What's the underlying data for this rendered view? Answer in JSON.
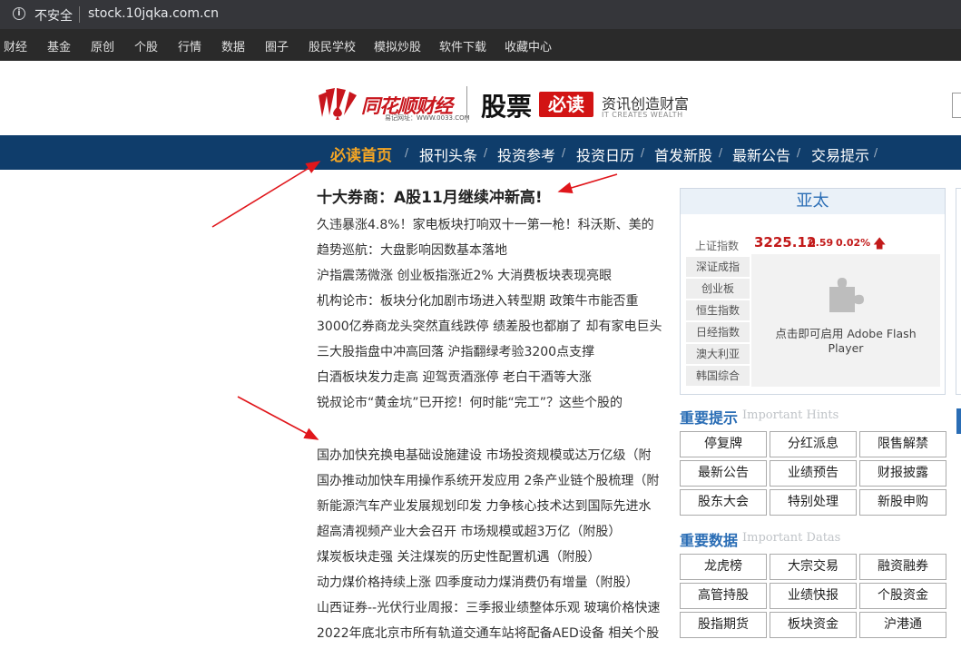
{
  "browser": {
    "security_label": "不安全",
    "url": "stock.10jqka.com.cn"
  },
  "bookmarks": [
    "财经",
    "基金",
    "原创",
    "个股",
    "行情",
    "数据",
    "圈子",
    "股民学校",
    "模拟炒股",
    "软件下载",
    "收藏中心"
  ],
  "header": {
    "logo_text": "同花顺财经",
    "logo_url_text": "易记网址：WWW.0033.COM",
    "section_title": "股票",
    "badge": "必读",
    "slogan_cn": "资讯创造财富",
    "slogan_en": "IT CREATES WEALTH"
  },
  "nav": {
    "items": [
      "必读首页",
      "报刊头条",
      "投资参考",
      "投资日历",
      "首发新股",
      "最新公告",
      "交易提示"
    ]
  },
  "main": {
    "headline": "十大券商：A股11月继续冲新高!",
    "news_group1": [
      "久违暴涨4.8%！家电板块打响双十一第一枪！科沃斯、美的",
      "趋势巡航：大盘影响因数基本落地",
      "沪指震荡微涨 创业板指涨近2% 大消费板块表现亮眼",
      "机构论市：板块分化加剧市场进入转型期 政策牛市能否重",
      "3000亿券商龙头突然直线跌停 绩差股也都崩了 却有家电巨头",
      "三大股指盘中冲高回落 沪指翻绿考验3200点支撑",
      "白酒板块发力走高 迎驾贡酒涨停 老白干酒等大涨",
      "锐叔论市“黄金坑”已开挖！何时能“完工”？这些个股的"
    ],
    "news_group2": [
      "国办加快充换电基础设施建设 市场投资规模或达万亿级（附",
      "国办推动加快车用操作系统开发应用 2条产业链个股梳理（附",
      "新能源汽车产业发展规划印发 力争核心技术达到国际先进水",
      "超高清视频产业大会召开 市场规模或超3万亿（附股）",
      "煤炭板块走强 关注煤炭的历史性配置机遇（附股）",
      "动力煤价格持续上涨 四季度动力煤消费仍有增量（附股）",
      "山西证券--光伏行业周报：三季报业绩整体乐观 玻璃价格快速",
      "2022年底北京市所有轨道交通车站将配备AED设备 相关个股"
    ]
  },
  "market": {
    "title": "亚太",
    "index_label": "上证指数",
    "index_value": "3225.12",
    "index_change": "0.59",
    "index_pct": "0.02%",
    "other_indices": [
      "深证成指",
      "创业板",
      "恒生指数",
      "日经指数",
      "澳大利亚",
      "韩国综合"
    ],
    "flash_message_line1": "点击即可启用 Adobe Flash",
    "flash_message_line2": "Player",
    "up_color": "#c21a1a"
  },
  "hints": {
    "title": "重要提示",
    "title_en": "Important Hints",
    "buttons": [
      "停复牌",
      "分红派息",
      "限售解禁",
      "最新公告",
      "业绩预告",
      "财报披露",
      "股东大会",
      "特别处理",
      "新股申购"
    ]
  },
  "datas": {
    "title": "重要数据",
    "title_en": "Important Datas",
    "buttons": [
      "龙虎榜",
      "大宗交易",
      "融资融券",
      "高管持股",
      "业绩快报",
      "个股资金",
      "股指期货",
      "板块资金",
      "沪港通"
    ]
  }
}
